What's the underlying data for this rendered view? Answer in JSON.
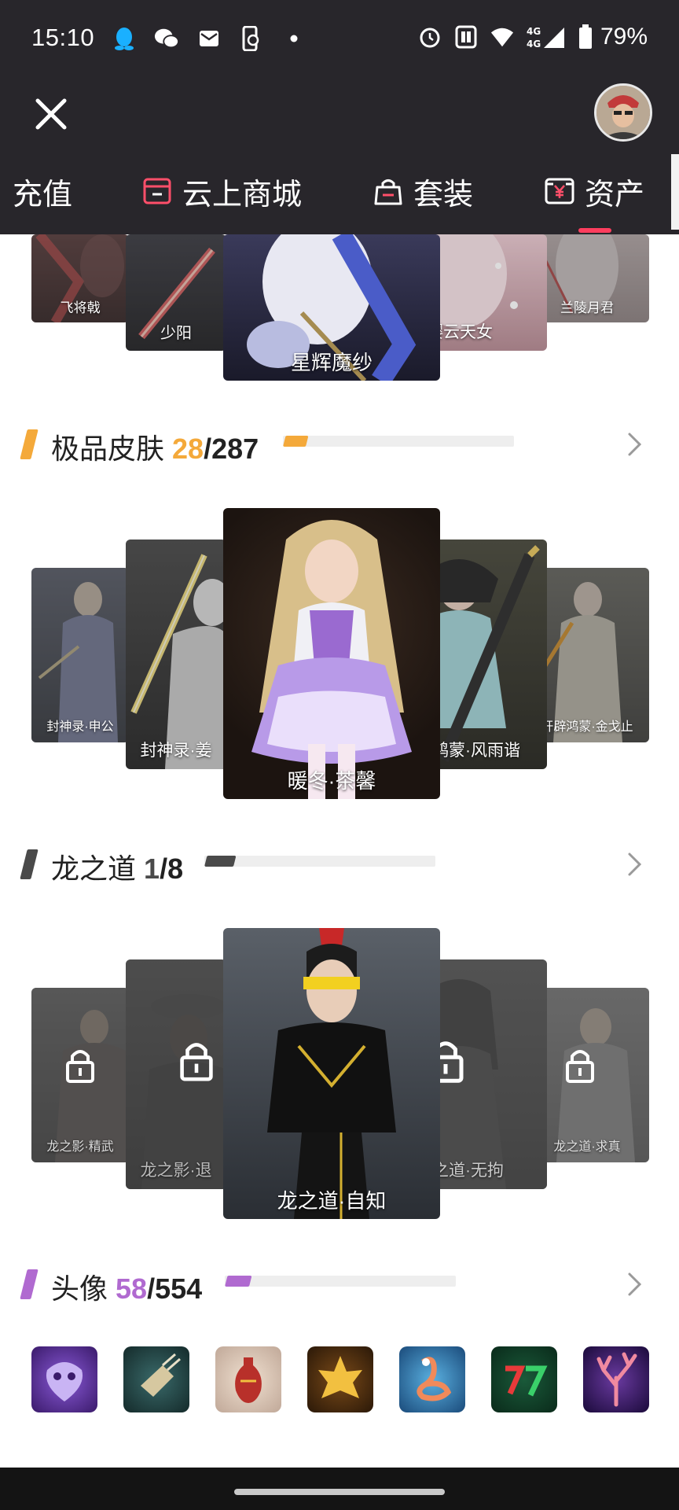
{
  "status_bar": {
    "time": "15:10",
    "notification_icons": [
      "qq-icon",
      "wechat-icon",
      "mail-icon",
      "phone-sync-icon",
      "dot-icon"
    ],
    "system_icons": [
      "alarm-icon",
      "nfc-icon",
      "wifi-icon",
      "signal-4g-icon",
      "battery-icon"
    ],
    "network_label": "4G",
    "battery": "79%"
  },
  "header": {
    "close_icon": "close-icon",
    "avatar_icon": "user-avatar"
  },
  "tabs": [
    {
      "label": "充值",
      "icon": ""
    },
    {
      "label": "云上商城",
      "icon": "store-icon"
    },
    {
      "label": "套装",
      "icon": "bag-icon"
    },
    {
      "label": "资产",
      "icon": "wallet-yen-icon",
      "active": true
    }
  ],
  "top_carousel": {
    "items": [
      {
        "name": "飞将戟"
      },
      {
        "name": "少阳"
      },
      {
        "name": "星辉魔纱"
      },
      {
        "name": "樱云天女"
      },
      {
        "name": "兰陵月君"
      }
    ]
  },
  "sections": {
    "skins": {
      "title": "极品皮肤",
      "count": "28",
      "total": "/287",
      "progress": 0.0976,
      "color": "#f4a93a",
      "items": [
        {
          "name": "封神录·申公"
        },
        {
          "name": "封神录·姜"
        },
        {
          "name": "暖冬·茶馨"
        },
        {
          "name": "开辟鸿蒙·风雨谐"
        },
        {
          "name": "开辟鸿蒙·金戈止"
        }
      ]
    },
    "dragon": {
      "title": "龙之道",
      "count": "1",
      "total": "/8",
      "progress": 0.125,
      "color": "#4a4a4a",
      "items": [
        {
          "name": "龙之影·精武",
          "locked": true
        },
        {
          "name": "龙之影·退",
          "locked": true
        },
        {
          "name": "龙之道·自知",
          "locked": false
        },
        {
          "name": "龙之道·无拘",
          "locked": true
        },
        {
          "name": "龙之道·求真",
          "locked": true
        }
      ]
    },
    "avatars": {
      "title": "头像",
      "count": "58",
      "total": "/554",
      "progress": 0.1047,
      "color": "#b06ad0",
      "items": [
        {
          "name": "purple-mask-avatar"
        },
        {
          "name": "glove-avatar"
        },
        {
          "name": "vase-avatar"
        },
        {
          "name": "golden-lotus-avatar"
        },
        {
          "name": "flamingo-avatar"
        },
        {
          "name": "number-27-avatar"
        },
        {
          "name": "coral-avatar"
        }
      ]
    }
  },
  "colors": {
    "header_bg": "#28262b",
    "accent": "#ff3e5e",
    "skins": "#f4a93a",
    "dragon": "#4a4a4a",
    "avatars": "#b06ad0"
  }
}
